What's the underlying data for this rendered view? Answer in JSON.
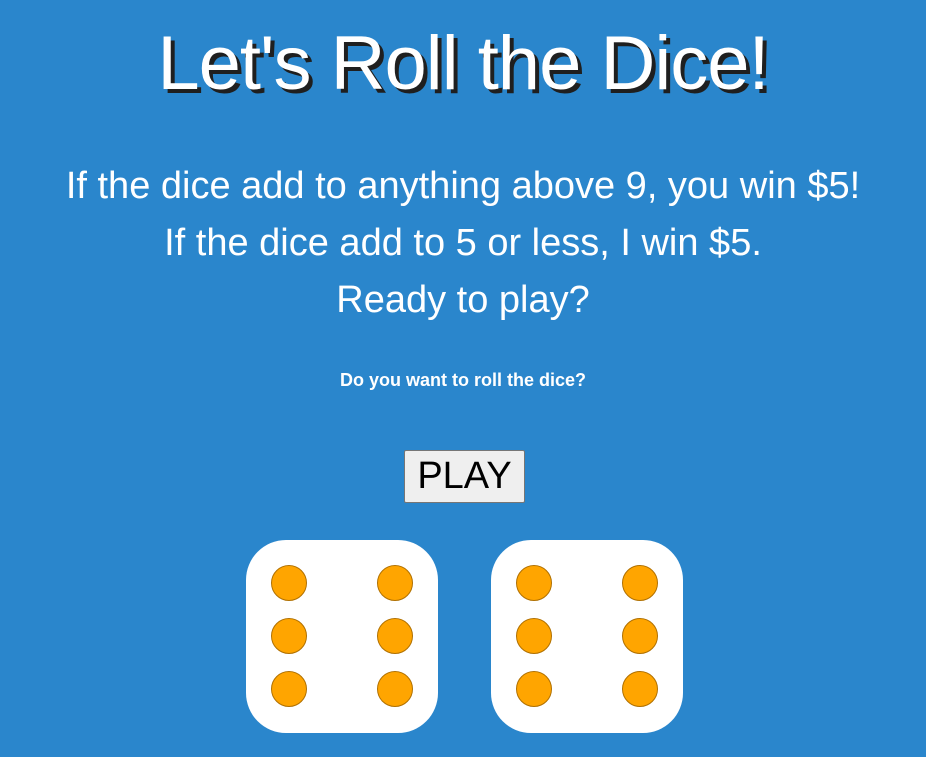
{
  "title": "Let's Roll the Dice!",
  "rules": [
    "If the dice add to anything above 9, you win $5!",
    "If the dice add to 5 or less, I win $5.",
    "Ready to play?"
  ],
  "question": "Do you want to roll the dice?",
  "play_button": "PLAY",
  "colors": {
    "background": "#2a86cc",
    "die_face": "#ffffff",
    "pip": "#ffa500"
  },
  "dice": [
    {
      "value": 6
    },
    {
      "value": 6
    }
  ]
}
